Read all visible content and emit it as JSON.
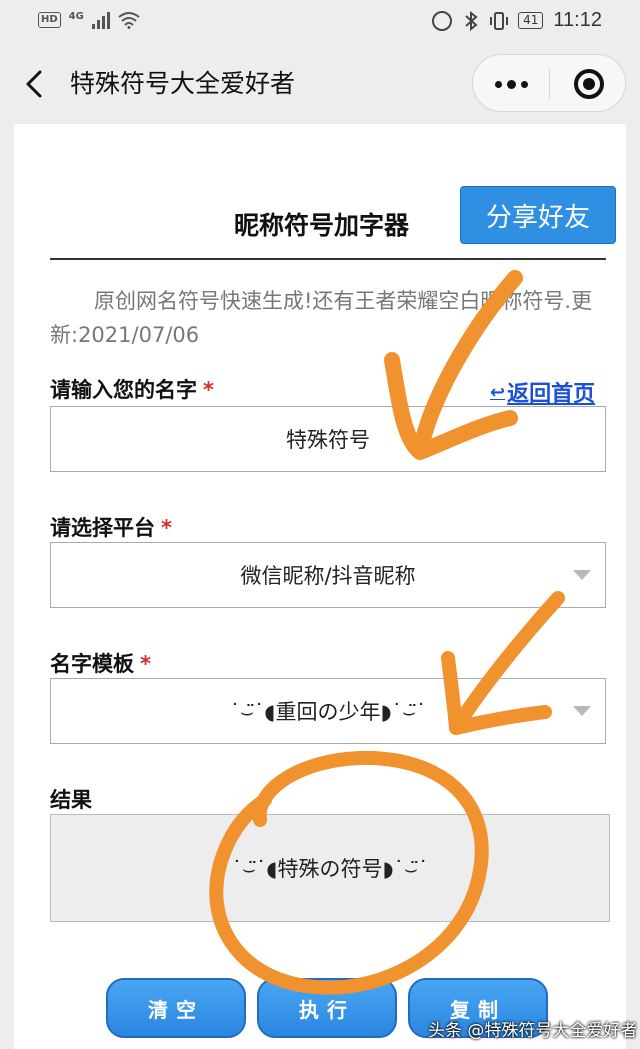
{
  "status_bar": {
    "hd": "HD",
    "network": "4G",
    "battery": "41",
    "time": "11:12"
  },
  "nav": {
    "title": "特殊符号大全爱好者"
  },
  "page": {
    "title": "昵称符号加字器",
    "share_label": "分享好友",
    "intro": "原创网名符号快速生成!还有王者荣耀空白昵称符号.更新:2021/07/06"
  },
  "form": {
    "name_label": "请输入您的名字",
    "required_mark": "*",
    "home_link": "返回首页",
    "home_link_arrow": "↩",
    "name_value": "特殊符号",
    "platform_label": "请选择平台",
    "platform_value": "微信昵称/抖音昵称",
    "template_label": "名字模板",
    "template_value": "˙⌣̈˙◖重回の少年◗˙⌣̈˙",
    "result_label": "结果",
    "result_value": "˙⌣̈˙◖特殊の符号◗˙⌣̈˙"
  },
  "actions": {
    "clear": "清空",
    "execute": "执行",
    "copy": "复制"
  },
  "watermark": "头条 @特殊符号大全爱好者",
  "colors": {
    "accent": "#2f8fe3",
    "link": "#1b4fd6",
    "required": "#d62b2b",
    "annotation": "#f0922e"
  },
  "icons": [
    "back-arrow-icon",
    "more-dots-icon",
    "target-circle-icon",
    "dropdown-caret-icon",
    "return-arrow-icon"
  ]
}
